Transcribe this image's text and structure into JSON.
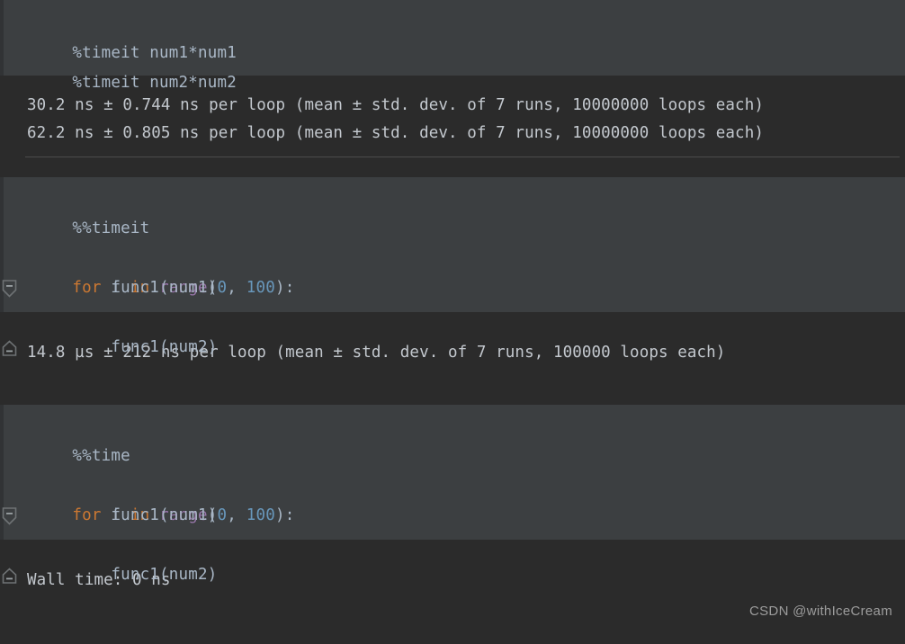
{
  "theme": {
    "background": "#2b2b2b",
    "cell_background": "#3c3f41",
    "gutter": "#313335",
    "text": "#a9b7c6",
    "output_text": "#c3c8ce",
    "keyword": "#cc7832",
    "function": "#9876aa",
    "number": "#6897bb",
    "divider": "#4b4b4b"
  },
  "cells": [
    {
      "id": "cell-1",
      "kind": "code",
      "lines": [
        {
          "tokens": [
            {
              "t": "%timeit num1*num1",
              "c": "pln"
            }
          ]
        },
        {
          "tokens": [
            {
              "t": "%timeit num2*num2",
              "c": "pln"
            }
          ]
        }
      ],
      "output": [
        "30.2 ns ± 0.744 ns per loop (mean ± std. dev. of 7 runs, 10000000 loops each)",
        "62.2 ns ± 0.805 ns per loop (mean ± std. dev. of 7 runs, 10000000 loops each)"
      ]
    },
    {
      "id": "cell-2",
      "kind": "code",
      "lines": [
        {
          "tokens": [
            {
              "t": "%%timeit",
              "c": "pln"
            }
          ]
        },
        {
          "fold": "open",
          "tokens": [
            {
              "t": "for",
              "c": "kw"
            },
            {
              "t": " i ",
              "c": "pln"
            },
            {
              "t": "in",
              "c": "kw"
            },
            {
              "t": " ",
              "c": "pln"
            },
            {
              "t": "range",
              "c": "fn"
            },
            {
              "t": "(",
              "c": "pln"
            },
            {
              "t": "0",
              "c": "num"
            },
            {
              "t": ", ",
              "c": "pln"
            },
            {
              "t": "100",
              "c": "num"
            },
            {
              "t": "):",
              "c": "pln"
            }
          ]
        },
        {
          "tokens": [
            {
              "t": "    func1(num1)",
              "c": "pln"
            }
          ]
        },
        {
          "fold": "end",
          "tokens": [
            {
              "t": "    func1(num2)",
              "c": "pln"
            }
          ]
        }
      ],
      "output": [
        "14.8 µs ± 212 ns per loop (mean ± std. dev. of 7 runs, 100000 loops each)"
      ]
    },
    {
      "id": "cell-3",
      "kind": "code",
      "lines": [
        {
          "tokens": [
            {
              "t": "%%time",
              "c": "pln"
            }
          ]
        },
        {
          "fold": "open",
          "tokens": [
            {
              "t": "for",
              "c": "kw"
            },
            {
              "t": " i ",
              "c": "pln"
            },
            {
              "t": "in",
              "c": "kw"
            },
            {
              "t": " ",
              "c": "pln"
            },
            {
              "t": "range",
              "c": "fn"
            },
            {
              "t": "(",
              "c": "pln"
            },
            {
              "t": "0",
              "c": "num"
            },
            {
              "t": ", ",
              "c": "pln"
            },
            {
              "t": "100",
              "c": "num"
            },
            {
              "t": "):",
              "c": "pln"
            }
          ]
        },
        {
          "tokens": [
            {
              "t": "    func1(num1)",
              "c": "pln"
            }
          ]
        },
        {
          "fold": "end",
          "tokens": [
            {
              "t": "    func1(num2)",
              "c": "pln"
            }
          ]
        }
      ],
      "output": [
        "Wall time: 0 ns"
      ]
    }
  ],
  "watermark": "CSDN @withIceCream"
}
